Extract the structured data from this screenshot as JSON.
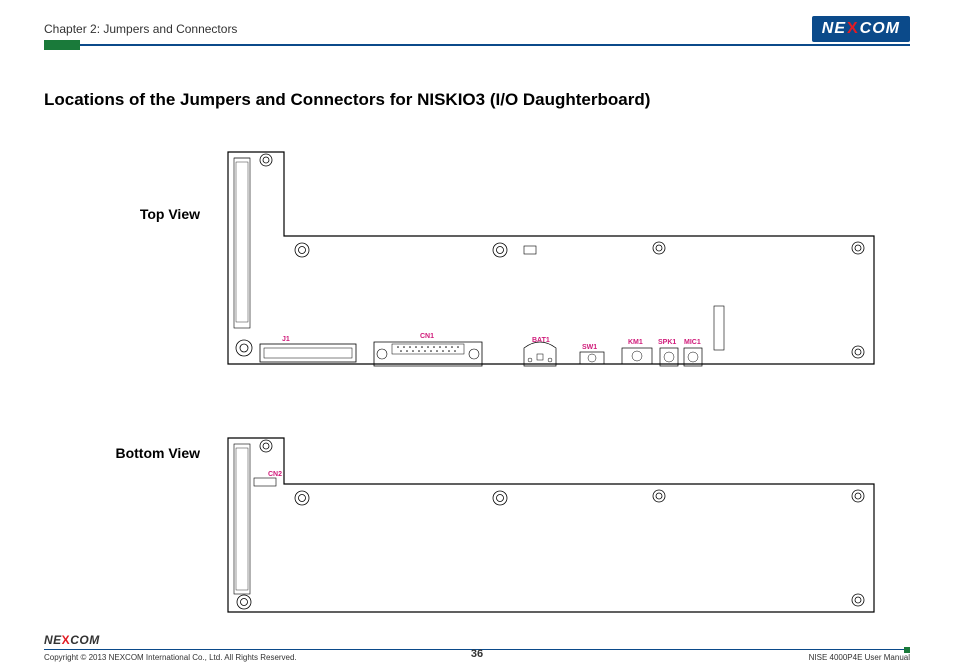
{
  "header": {
    "chapter": "Chapter 2: Jumpers and Connectors",
    "logo_pre": "NE",
    "logo_x": "X",
    "logo_post": "COM"
  },
  "title": "Locations of the Jumpers and Connectors for NISKIO3 (I/O Daughterboard)",
  "views": {
    "top": "Top View",
    "bottom": "Bottom View"
  },
  "connectors": {
    "j1": "J1",
    "cn1": "CN1",
    "bat1": "BAT1",
    "sw1": "SW1",
    "km1": "KM1",
    "spk1": "SPK1",
    "mic1": "MIC1",
    "cn2": "CN2"
  },
  "footer": {
    "copyright": "Copyright © 2013 NEXCOM International Co., Ltd. All Rights Reserved.",
    "page": "36",
    "manual": "NISE 4000P4E User Manual",
    "logo_pre": "NE",
    "logo_x": "X",
    "logo_post": "COM"
  }
}
